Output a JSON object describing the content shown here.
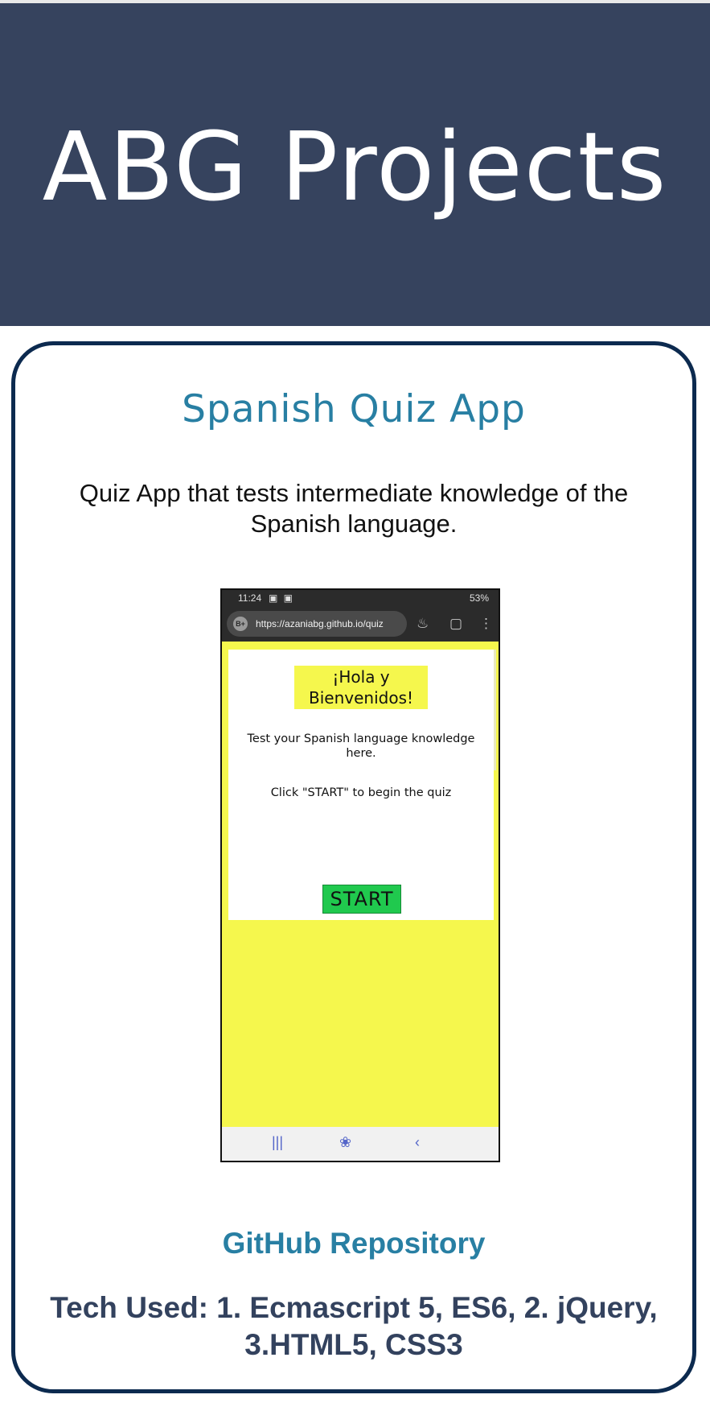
{
  "header": {
    "title": "ABG Projects",
    "background_color": "#36435e"
  },
  "project": {
    "title": "Spanish Quiz App",
    "description": "Quiz App that tests intermediate knowledge of the Spanish language.",
    "repo_link_label": "GitHub Repository",
    "tech_used": "Tech Used: 1. Ecmascript 5, ES6, 2. jQuery, 3.HTML5, CSS3",
    "accent_color": "#287fa3",
    "border_color": "#0c2a4f"
  },
  "screenshot": {
    "status_time": "11:24",
    "status_right": "53%",
    "url_badge": "B+",
    "url": "https://azaniabg.github.io/quiz",
    "quiz_title": "¡Hola y Bienvenidos!",
    "quiz_text": "Test your Spanish language knowledge here.",
    "quiz_hint": "Click \"START\" to begin the quiz",
    "start_label": "START",
    "page_bg_color": "#f5f74d",
    "start_color": "#20c94e",
    "icons": [
      "flame-icon",
      "tab-switcher-icon",
      "menu-dots-icon",
      "recents-icon",
      "home-lotus-icon",
      "back-icon"
    ]
  }
}
